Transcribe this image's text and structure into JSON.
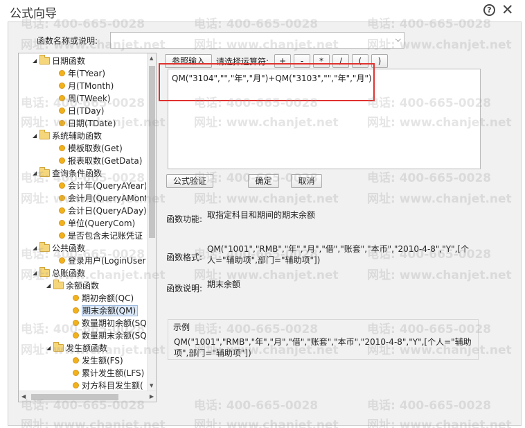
{
  "window": {
    "title": "公式向导"
  },
  "search": {
    "label": "函数名称或说明:"
  },
  "tree": {
    "items": [
      {
        "label": "日期函数"
      },
      {
        "label": "年(TYear)"
      },
      {
        "label": "月(TMonth)"
      },
      {
        "label": "周(TWeek)"
      },
      {
        "label": "日(TDay)"
      },
      {
        "label": "日期(TDate)"
      },
      {
        "label": "系统辅助函数"
      },
      {
        "label": "模板取数(Get)"
      },
      {
        "label": "报表取数(GetData)"
      },
      {
        "label": "查询条件函数"
      },
      {
        "label": "会计年(QueryAYear)"
      },
      {
        "label": "会计月(QueryAMont"
      },
      {
        "label": "会计日(QueryADay)"
      },
      {
        "label": "单位(QueryCom)"
      },
      {
        "label": "是否包含未记账凭证"
      },
      {
        "label": "公共函数"
      },
      {
        "label": "登录用户(LoginUser"
      },
      {
        "label": "总账函数"
      },
      {
        "label": "余额函数"
      },
      {
        "label": "期初余额(QC)"
      },
      {
        "label": "期末余额(QM)"
      },
      {
        "label": "数量期初余额(SQ"
      },
      {
        "label": "数量期末余额(SQ"
      },
      {
        "label": "发生额函数"
      },
      {
        "label": "发生额(FS)"
      },
      {
        "label": "累计发生额(LFS)"
      },
      {
        "label": "对方科目发生额("
      }
    ]
  },
  "toolbar": {
    "ref_input_label": "参照输入",
    "op_prompt": "请选择运算符:",
    "ops": [
      "+",
      "-",
      "*",
      "/",
      "(",
      ")"
    ]
  },
  "formula": {
    "value": "QM(\"3104\",\"\",\"年\",\"月\")+QM(\"3103\",\"\",\"年\",\"月\")"
  },
  "actions": {
    "validate_label": "公式验证",
    "ok_label": "确定",
    "cancel_label": "取消"
  },
  "info": {
    "function_label": "函数功能:",
    "function_value": "取指定科目和期间的期末余额",
    "format_label": "函数格式:",
    "format_value": "QM(\"1001\",\"RMB\",\"年\",\"月\",\"借\",\"账套\",\"本币\",\"2010-4-8\",\"Y\",[个人=\"辅助项\",部门=\"辅助项\"])",
    "desc_label": "函数说明:",
    "desc_value": "期末余额"
  },
  "example": {
    "title": "示例",
    "text": "QM(\"1001\",\"RMB\",\"年\",\"月\",\"借\",\"账套\",\"本币\",\"2010-4-8\",\"Y\",[个人=\"辅助项\",部门=\"辅助项\"])"
  },
  "watermark": {
    "phone": "电话: 400-665-0028",
    "site": "网址: www.chanjet.net"
  }
}
